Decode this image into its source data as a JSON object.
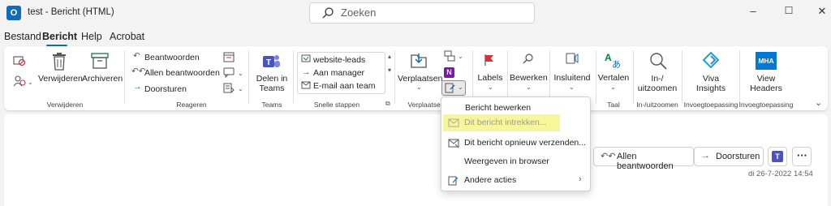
{
  "window": {
    "title": "test - Bericht (HTML)",
    "search_placeholder": "Zoeken",
    "minimize": "–",
    "maximize": "☐",
    "close": "✕"
  },
  "tabs": [
    "Bestand",
    "Bericht",
    "Help",
    "Acrobat"
  ],
  "ribbon": {
    "verwijderen": {
      "delete": "Verwijderen",
      "archive": "Archiveren",
      "group": "Verwijderen"
    },
    "reageren": {
      "reply": "Beantwoorden",
      "reply_all": "Allen beantwoorden",
      "forward": "Doorsturen",
      "group": "Reageren"
    },
    "teams": {
      "share_line1": "Delen in",
      "share_line2": "Teams",
      "group": "Teams"
    },
    "snelle_stappen": {
      "items": [
        "website-leads",
        "Aan manager",
        "E-mail aan team"
      ],
      "group": "Snelle stappen"
    },
    "verplaatsen": {
      "move": "Verplaatsen",
      "group": "Verplaatsen"
    },
    "labels": {
      "label": "Labels"
    },
    "bewerken": {
      "label": "Bewerken"
    },
    "insluitend": {
      "label": "Insluitend"
    },
    "taal": {
      "translate": "Vertalen",
      "group": "Taal"
    },
    "zoom": {
      "line1": "In-/",
      "line2": "uitzoomen",
      "group": "In-/uitzoomen"
    },
    "viva": {
      "line1": "Viva",
      "line2": "Insights",
      "group": "Invoegtoepassing"
    },
    "mha": {
      "badge": "MHA",
      "line1": "View",
      "line2": "Headers",
      "group": "Invoegtoepassing"
    }
  },
  "dropdown": {
    "items": [
      {
        "label": "Bericht bewerken",
        "enabled": true
      },
      {
        "label": "Dit bericht intrekken...",
        "enabled": false
      },
      {
        "label": "Dit bericht opnieuw verzenden...",
        "enabled": true
      },
      {
        "label": "Weergeven in browser",
        "enabled": true
      },
      {
        "label": "Andere acties",
        "enabled": true
      }
    ]
  },
  "reading_pane": {
    "reply_all": "Allen beantwoorden",
    "forward": "Doorsturen",
    "date": "di 26-7-2022 14:54"
  },
  "colors": {
    "accent": "#0f6cbd",
    "highlight": "#f7f79a",
    "teams": "#4b53bc",
    "onenote": "#7719aa"
  }
}
